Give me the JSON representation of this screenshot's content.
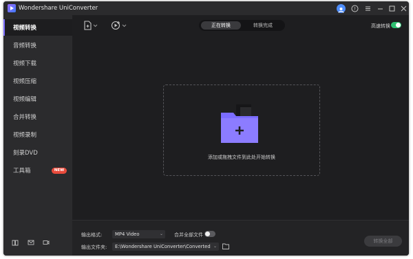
{
  "window": {
    "title": "Wondershare UniConverter"
  },
  "titlebar": {
    "icons": [
      "user-icon",
      "help-icon",
      "menu-icon",
      "minimize-icon",
      "maximize-icon",
      "close-icon"
    ]
  },
  "sidebar": {
    "items": [
      {
        "label": "视频转换",
        "active": true
      },
      {
        "label": "音频转换"
      },
      {
        "label": "视频下载"
      },
      {
        "label": "视频压缩"
      },
      {
        "label": "视频编辑"
      },
      {
        "label": "合并转换"
      },
      {
        "label": "视频录制"
      },
      {
        "label": "刻录DVD"
      },
      {
        "label": "工具箱",
        "badge": "NEW"
      }
    ],
    "bottom_icons": [
      "book-icon",
      "mail-icon",
      "video-call-icon"
    ]
  },
  "toolbar": {
    "add_file_icon": "add-file-icon",
    "add_from_device_icon": "add-media-icon",
    "tabs": [
      {
        "label": "正在转换",
        "active": true
      },
      {
        "label": "转换完成"
      }
    ],
    "fast_convert_label": "高速转换",
    "fast_convert_on": true
  },
  "dropzone": {
    "text": "添加或拖拽文件到此处开始转换",
    "icon": "add-folder-icon"
  },
  "bottom": {
    "output_format_label": "输出格式:",
    "output_format_value": "MP4 Video",
    "merge_label": "合并全部文件",
    "merge_on": false,
    "output_folder_label": "输出文件夹:",
    "output_folder_value": "E:\\Wondershare UniConverter\\Converted",
    "convert_all_label": "转换全部"
  },
  "colors": {
    "accent": "#7b6cff",
    "toggle_on": "#2fbf71",
    "badge": "#e84b3c",
    "user": "#4e8dfb"
  }
}
